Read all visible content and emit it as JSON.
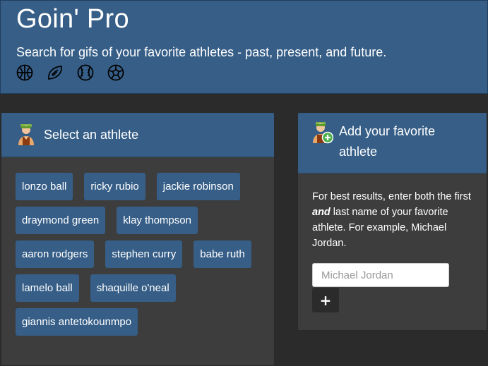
{
  "header": {
    "title": "Goin' Pro",
    "tagline": "Search for gifs of your favorite athletes - past, present, and future.",
    "icons": [
      "basketball-icon",
      "football-icon",
      "baseball-icon",
      "soccer-ball-icon"
    ]
  },
  "athlete_panel": {
    "heading": "Select an athlete",
    "icon": "athlete-avatar-icon",
    "athletes": [
      "lonzo ball",
      "ricky rubio",
      "jackie robinson",
      "draymond green",
      "klay thompson",
      "aaron rodgers",
      "stephen curry",
      "babe ruth",
      "lamelo ball",
      "shaquille o'neal",
      "giannis antetokounmpo"
    ]
  },
  "add_panel": {
    "heading": "Add your favorite athlete",
    "icon": "add-athlete-icon",
    "instructions_pre": "For best results, enter both the first ",
    "instructions_emph": "and",
    "instructions_post": " last name of your favorite athlete. For example, Michael Jordan.",
    "input_placeholder": "Michael Jordan",
    "input_value": "",
    "add_button_label": "+"
  },
  "colors": {
    "background": "#2b2b2b",
    "primary": "#365e87",
    "panel_body": "#3d3d3d",
    "text": "#ffffff"
  }
}
